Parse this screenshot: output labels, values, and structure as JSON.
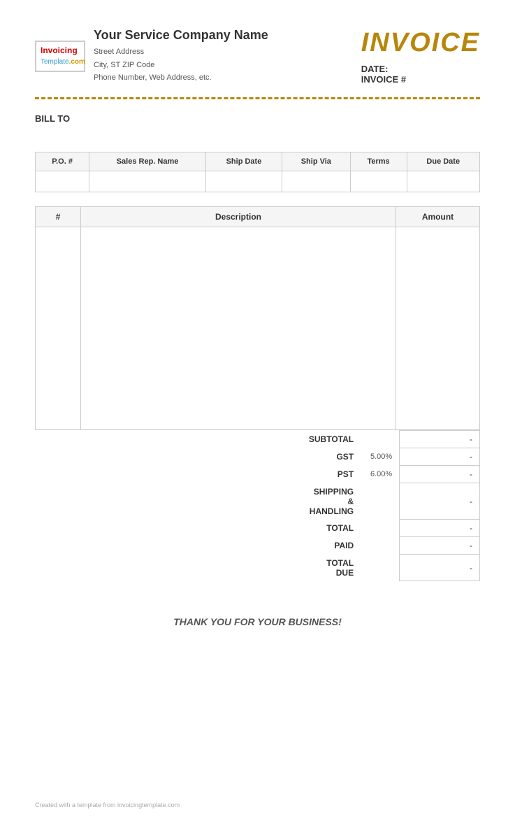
{
  "header": {
    "company_name": "Your Service Company Name",
    "street_address": "Street Address",
    "city_state_zip": "City, ST  ZIP Code",
    "phone_web": "Phone Number, Web Address, etc.",
    "invoice_title": "INVOICE",
    "date_label": "DATE:",
    "invoice_num_label": "INVOICE #"
  },
  "logo": {
    "invoicing": "Invoicing",
    "template": "Template",
    "dot_com": ".com"
  },
  "bill_to": {
    "label": "BILL TO"
  },
  "info_table": {
    "headers": [
      "P.O. #",
      "Sales Rep. Name",
      "Ship Date",
      "Ship Via",
      "Terms",
      "Due Date"
    ],
    "row": [
      "",
      "",
      "",
      "",
      "",
      ""
    ]
  },
  "items_table": {
    "headers": [
      "#",
      "Description",
      "Amount"
    ],
    "rows": [
      {
        "num": "",
        "desc": "",
        "amount": ""
      },
      {
        "num": "",
        "desc": "",
        "amount": ""
      },
      {
        "num": "",
        "desc": "",
        "amount": ""
      },
      {
        "num": "",
        "desc": "",
        "amount": ""
      },
      {
        "num": "",
        "desc": "",
        "amount": ""
      },
      {
        "num": "",
        "desc": "",
        "amount": ""
      },
      {
        "num": "",
        "desc": "",
        "amount": ""
      }
    ]
  },
  "totals": {
    "subtotal_label": "SUBTOTAL",
    "subtotal_value": "-",
    "gst_label": "GST",
    "gst_rate": "5.00%",
    "gst_value": "-",
    "pst_label": "PST",
    "pst_rate": "6.00%",
    "pst_value": "-",
    "shipping_label": "SHIPPING & HANDLING",
    "shipping_value": "-",
    "total_label": "TOTAL",
    "total_value": "-",
    "paid_label": "PAID",
    "paid_value": "-",
    "total_due_label": "TOTAL DUE",
    "total_due_value": "-"
  },
  "footer_message": "THANK YOU FOR YOUR BUSINESS!",
  "footer_credit": "Created with a template from invoicingtemplate.com"
}
